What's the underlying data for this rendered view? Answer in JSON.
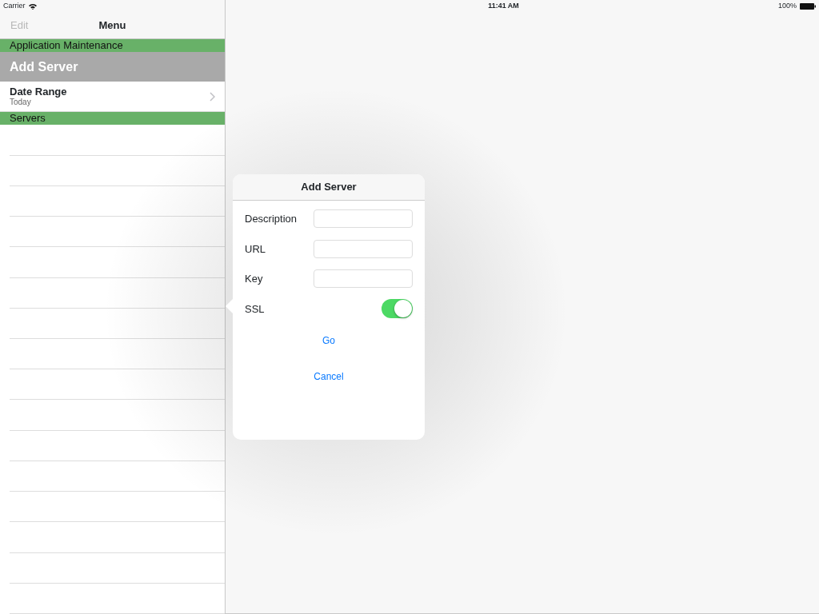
{
  "status_bar": {
    "carrier": "Carrier",
    "time": "11:41 AM",
    "battery": "100%"
  },
  "nav_bar": {
    "edit": {
      "label": "Edit",
      "disabled": true
    },
    "title": "Menu"
  },
  "menu": [
    {
      "kind": "header",
      "label": "Application Maintenance"
    },
    {
      "kind": "action",
      "label": "Add Server",
      "selected": true
    },
    {
      "kind": "detail",
      "label": "Date Range",
      "subtitle": "Today",
      "selected": false
    },
    {
      "kind": "header",
      "label": "Servers"
    }
  ],
  "popover": {
    "title": "Add Server",
    "fields": [
      {
        "kind": "text",
        "label": "Description"
      },
      {
        "kind": "text",
        "label": "URL"
      },
      {
        "kind": "text",
        "label": "Key"
      },
      {
        "kind": "switch",
        "label": "SSL",
        "on": true
      }
    ],
    "buttons": [
      "Go",
      "Cancel"
    ]
  }
}
